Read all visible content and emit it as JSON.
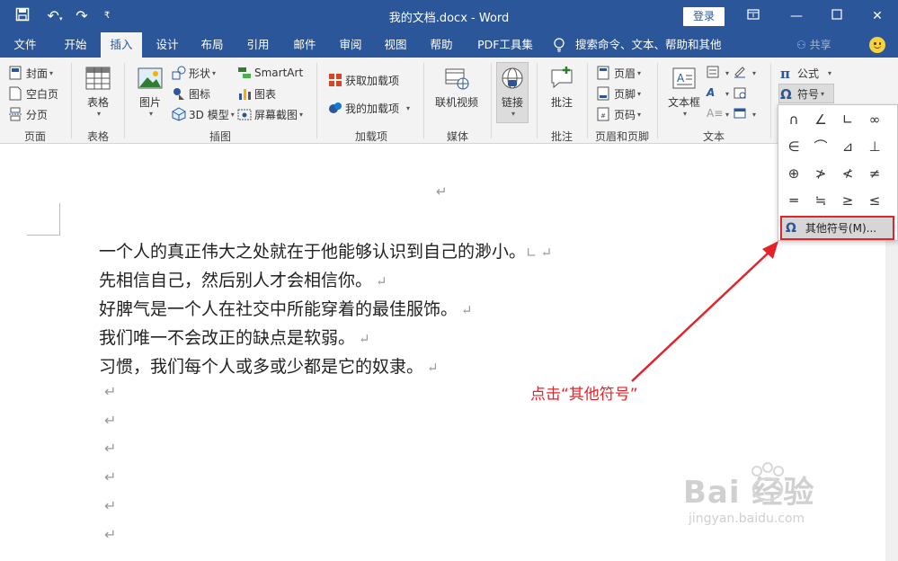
{
  "titlebar": {
    "title": "我的文档.docx  -  Word",
    "login": "登录"
  },
  "tabs": [
    {
      "label": "文件"
    },
    {
      "label": "开始"
    },
    {
      "label": "插入"
    },
    {
      "label": "设计"
    },
    {
      "label": "布局"
    },
    {
      "label": "引用"
    },
    {
      "label": "邮件"
    },
    {
      "label": "审阅"
    },
    {
      "label": "视图"
    },
    {
      "label": "帮助"
    },
    {
      "label": "PDF工具集"
    }
  ],
  "tell_me": "搜索命令、文本、帮助和其他",
  "share": "共享",
  "ribbon": {
    "pages": {
      "cover": "封面",
      "blank": "空白页",
      "break": "分页",
      "label": "页面"
    },
    "table": {
      "btn": "表格",
      "label": "表格"
    },
    "illustrations": {
      "picture": "图片",
      "shapes": "形状",
      "icons": "图标",
      "model3d": "3D 模型",
      "smartart": "SmartArt",
      "chart": "图表",
      "screenshot": "屏幕截图",
      "label": "插图"
    },
    "addins": {
      "get": "获取加载项",
      "my": "我的加载项",
      "label": "加载项"
    },
    "media": {
      "video": "联机视频",
      "label": "媒体"
    },
    "links": {
      "link": "链接"
    },
    "comments": {
      "comment": "批注",
      "label": "批注"
    },
    "header_footer": {
      "header": "页眉",
      "footer": "页脚",
      "page_number": "页码",
      "label": "页眉和页脚"
    },
    "text": {
      "textbox": "文本框",
      "label": "文本"
    },
    "symbols": {
      "equation": "公式",
      "symbol": "符号"
    }
  },
  "symbols_grid": [
    "∩",
    "∠",
    "∟",
    "∞",
    "∈",
    "⌒",
    "⊿",
    "⊥",
    "⊕",
    "≯",
    "≮",
    "≠",
    "═",
    "≒",
    "≥",
    "≤"
  ],
  "more_symbols": "其他符号(M)...",
  "document": {
    "lines": [
      "一个人的真正伟大之处就在于他能够认识到自己的渺小。",
      "先相信自己，然后别人才会相信你。",
      "好脾气是一个人在社交中所能穿着的最佳服饰。",
      "我们唯一不会改正的缺点是软弱。",
      "习惯，我们每个人或多或少都是它的奴隶。"
    ],
    "paragraph_mark": "↵"
  },
  "annotation": "点击“其他符号”",
  "watermark": {
    "brand": "Bai  经验",
    "url": "jingyan.baidu.com"
  }
}
